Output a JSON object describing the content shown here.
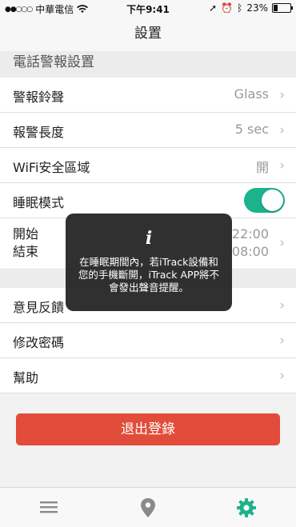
{
  "status_bar": {
    "carrier": "中華電信",
    "time": "下午9:41",
    "battery": "23%",
    "battery_level": 0.23
  },
  "nav": {
    "title": "設置"
  },
  "section": {
    "header": "電話警報設置"
  },
  "rows": [
    {
      "label": "警報鈴聲",
      "value": "Glass"
    },
    {
      "label": "報警長度",
      "value": "5 sec"
    },
    {
      "label": "WiFi安全區域",
      "value": "開"
    },
    {
      "label": "睡眠模式",
      "toggle_on": true
    },
    {
      "label_start": "開始",
      "label_end": "結束",
      "value_start": "22:00",
      "value_end": "08:00"
    }
  ],
  "rows2": [
    {
      "label": "意見反饋"
    },
    {
      "label": "修改密碼"
    },
    {
      "label": "幫助"
    }
  ],
  "logout_label": "退出登錄",
  "toast": {
    "icon": "info-icon",
    "message": "在睡眠期間內，若iTrack設備和您的手機斷開，iTrack APP將不會發出聲音提醒。"
  },
  "tabs": [
    {
      "icon": "menu-icon"
    },
    {
      "icon": "location-pin-icon"
    },
    {
      "icon": "gear-icon",
      "active": true
    }
  ],
  "colors": {
    "accent": "#1bb28c",
    "logout": "#e24c3a"
  }
}
